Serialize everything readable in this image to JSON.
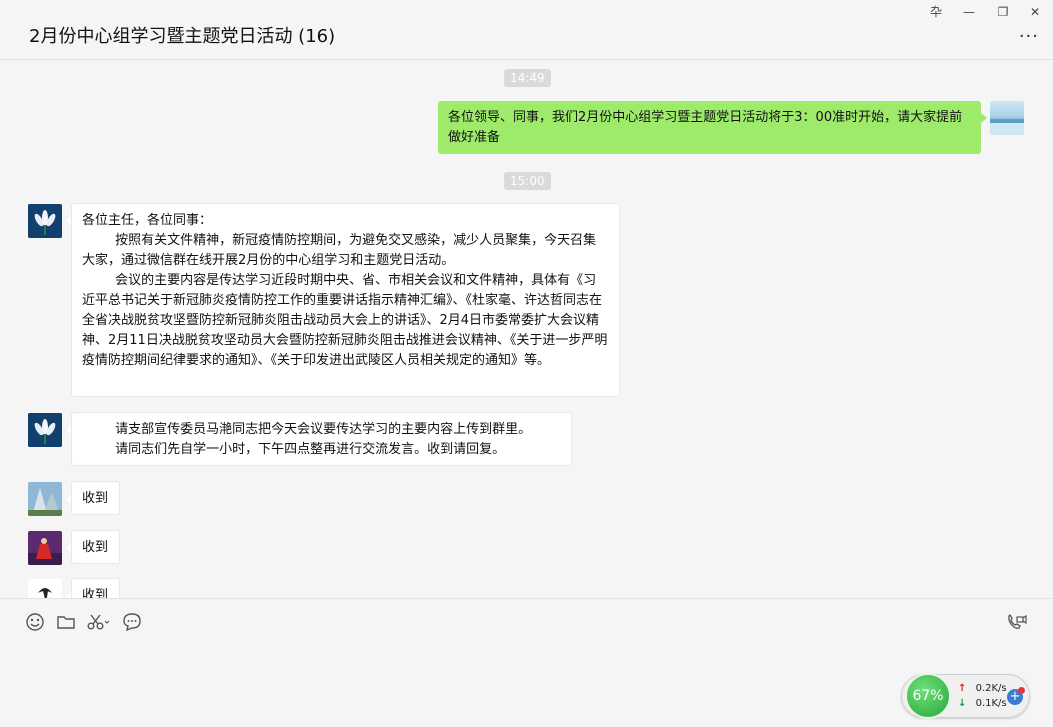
{
  "window": {
    "title": "2月份中心组学习暨主题党日活动 (16)",
    "pin_glyph": "卆",
    "minimize_glyph": "—",
    "maximize_glyph": "❐",
    "close_glyph": "✕",
    "more_glyph": "···"
  },
  "messages": {
    "time1": "14:49",
    "out1_text": "各位领导、同事，我们2月份中心组学习暨主题党日活动将于3：00准时开始，请大家提前做好准备",
    "time2": "15:00",
    "in1_text": "各位主任，各位同事：\n        按照有关文件精神，新冠疫情防控期间，为避免交叉感染，减少人员聚集，今天召集大家，通过微信群在线开展2月份的中心组学习和主题党日活动。\n        会议的主要内容是传达学习近段时期中央、省、市相关会议和文件精神，具体有《习近平总书记关于新冠肺炎疫情防控工作的重要讲话指示精神汇编》、《杜家毫、许达哲同志在全省决战脱贫攻坚暨防控新冠肺炎阻击战动员大会上的讲话》、2月4日市委常委扩大会议精神、2月11日决战脱贫攻坚动员大会暨防控新冠肺炎阻击战推进会议精神、《关于进一步严明疫情防控期间纪律要求的通知》、《关于印发进出武陵区人员相关规定的通知》等。",
    "in2_text": "        请支部宣传委员马滟同志把今天会议要传达学习的主要内容上传到群里。\n        请同志们先自学一小时，下午四点整再进行交流发言。收到请回复。",
    "reply1": "收到",
    "reply2": "收到",
    "reply3": "收到"
  },
  "toolbar": {
    "icons": [
      "emoji-icon",
      "folder-icon",
      "scissors-icon",
      "chat-bubble-icon",
      "video-call-icon"
    ]
  },
  "network_widget": {
    "percent": "67%",
    "upload": "0.2K/s",
    "download": "0.1K/s",
    "up_arrow": "↑",
    "down_arrow": "↓",
    "plus": "+"
  },
  "colors": {
    "outgoing_bubble": "#9eea6a",
    "incoming_bubble": "#ffffff",
    "background": "#f5f5f5"
  }
}
